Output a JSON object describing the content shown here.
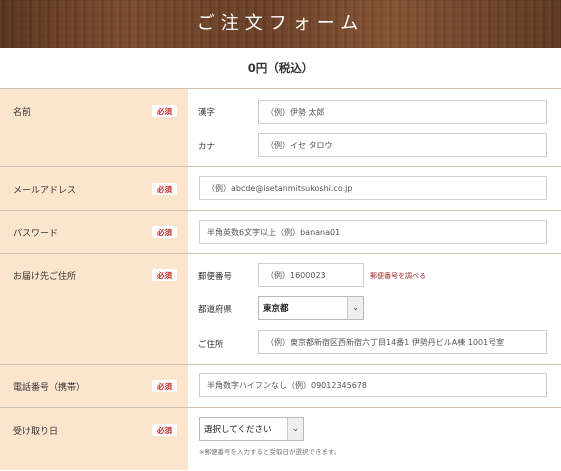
{
  "header": {
    "title": "ご注文フォーム"
  },
  "total": "0円（税込）",
  "required_label": "必須",
  "rows": {
    "name": {
      "label": "名前",
      "kanji_label": "漢字",
      "kanji_placeholder": "（例）伊勢 太郎",
      "kana_label": "カナ",
      "kana_placeholder": "（例）イセ タロウ"
    },
    "email": {
      "label": "メールアドレス",
      "placeholder": "（例）abcde@isetanmitsukoshi.co.jp"
    },
    "password": {
      "label": "パスワード",
      "placeholder": "半角英数6文字以上（例）banana01"
    },
    "address": {
      "label": "お届け先ご住所",
      "postal_label": "郵便番号",
      "postal_placeholder": "（例）1600023",
      "postal_lookup_link": "郵便番号を調べる",
      "prefecture_label": "都道府県",
      "prefecture_value": "東京都",
      "address_label": "ご住所",
      "address_placeholder": "（例）東京都新宿区西新宿六丁目14番1 伊勢丹ビルA棟 1001号室"
    },
    "phone": {
      "label": "電話番号（携帯）",
      "placeholder": "半角数字ハイフンなし（例）09012345678"
    },
    "pickup": {
      "label": "受け取り日",
      "select_value": "選択してください",
      "note": "※郵便番号を入力すると受取日が選択できます。"
    }
  },
  "icons": {
    "dropdown": "chevron-down-icon"
  }
}
